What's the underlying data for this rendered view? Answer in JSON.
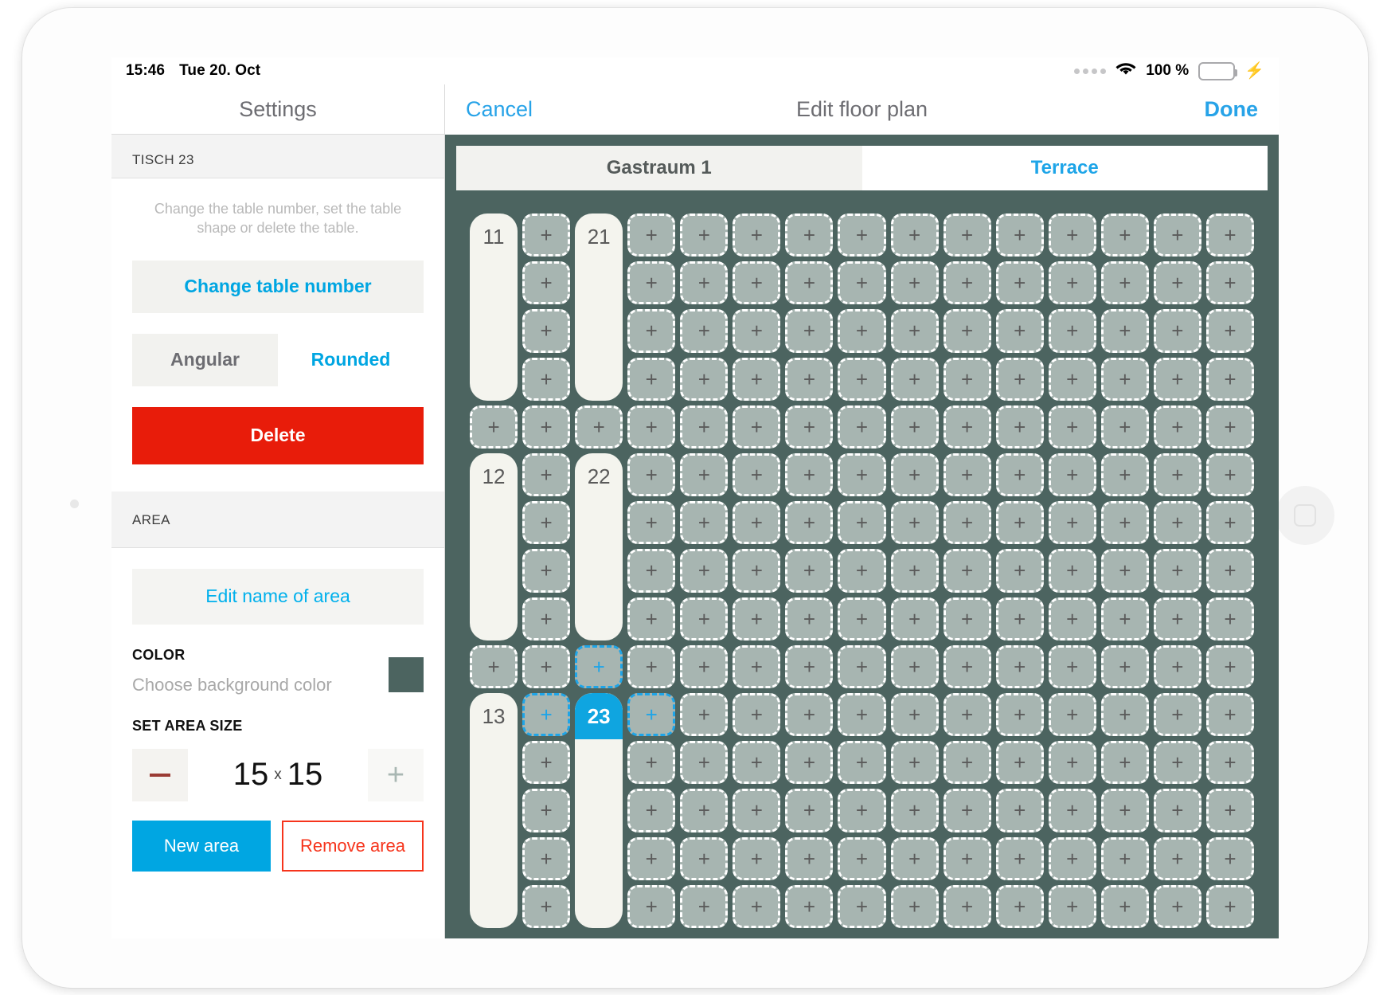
{
  "status_bar": {
    "time": "15:46",
    "date": "Tue 20. Oct",
    "battery_percent": "100 %",
    "dots_icon": "signal-dots-icon",
    "wifi_icon": "wifi-icon",
    "battery_icon": "battery-full-icon",
    "charging_icon": "lightning-bolt-icon"
  },
  "sidebar": {
    "nav_title": "Settings",
    "table_section_header": "TISCH 23",
    "help_text": "Change the table number, set the table shape or delete the table.",
    "change_number_label": "Change table number",
    "shape_segment": {
      "angular_label": "Angular",
      "rounded_label": "Rounded",
      "selected": "Rounded"
    },
    "delete_label": "Delete",
    "area_section_header": "AREA",
    "edit_area_name_label": "Edit name of area",
    "color_label": "COLOR",
    "color_description": "Choose background color",
    "color_swatch_hex": "#4c6460",
    "size_label": "SET AREA SIZE",
    "size_value": {
      "width": "15",
      "separator": "x",
      "height": "15"
    },
    "minus_label": "−",
    "plus_label": "+",
    "new_area_label": "New area",
    "remove_area_label": "Remove area"
  },
  "detail": {
    "cancel_label": "Cancel",
    "title": "Edit floor plan",
    "done_label": "Done",
    "tabs": [
      {
        "label": "Gastraum 1",
        "selected": false
      },
      {
        "label": "Terrace",
        "selected": true
      }
    ],
    "accent_hex": "#1ea5e8",
    "plan_background_hex": "#4c6460"
  },
  "floor_plan": {
    "columns": 15,
    "rows": 15,
    "cell_plus_label": "+",
    "tables": [
      {
        "number": "11",
        "col": 0,
        "row": 0,
        "row_span": 4,
        "selected": false
      },
      {
        "number": "21",
        "col": 2,
        "row": 0,
        "row_span": 4,
        "selected": false
      },
      {
        "number": "12",
        "col": 0,
        "row": 5,
        "row_span": 4,
        "selected": false
      },
      {
        "number": "22",
        "col": 2,
        "row": 5,
        "row_span": 4,
        "selected": false
      },
      {
        "number": "13",
        "col": 0,
        "row": 10,
        "row_span": 5,
        "selected": false
      },
      {
        "number": "23",
        "col": 2,
        "row": 10,
        "row_span": 5,
        "selected": true
      }
    ],
    "highlighted_cells": [
      {
        "col": 2,
        "row": 9
      },
      {
        "col": 1,
        "row": 10
      },
      {
        "col": 3,
        "row": 10
      }
    ]
  }
}
